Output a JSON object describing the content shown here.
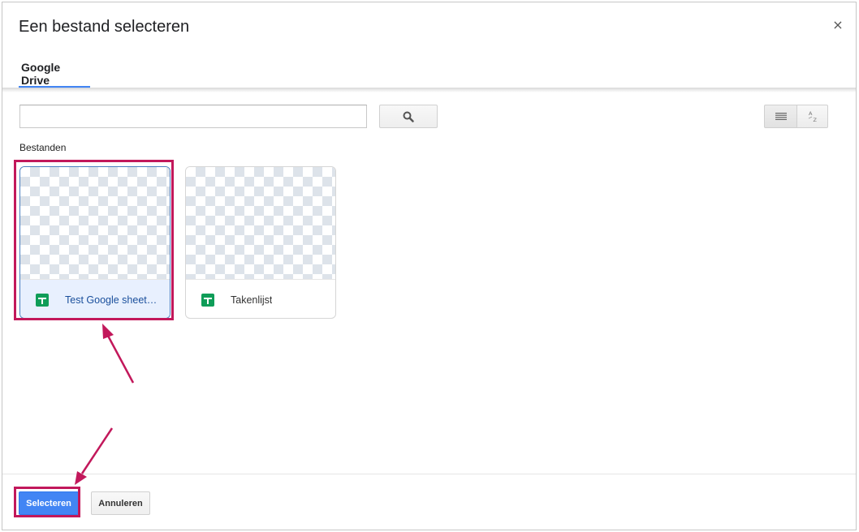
{
  "dialog": {
    "title": "Een bestand selecteren",
    "close_glyph": "×"
  },
  "tabs": [
    {
      "label": "Google Drive",
      "active": true
    }
  ],
  "search": {
    "value": "",
    "placeholder": ""
  },
  "view": {
    "list_icon": "list-view-icon",
    "sort_icon": "sort-az-icon"
  },
  "files_section": {
    "label": "Bestanden",
    "items": [
      {
        "name": "Test Google sheet…",
        "type": "sheets-icon",
        "selected": true
      },
      {
        "name": "Takenlijst",
        "type": "sheets-icon",
        "selected": false
      }
    ]
  },
  "footer": {
    "select_label": "Selecteren",
    "cancel_label": "Annuleren"
  },
  "colors": {
    "accent": "#4285f4",
    "annotation": "#c2185b",
    "sheets_green": "#0f9d58",
    "selected_bg": "#e8f0fe"
  }
}
